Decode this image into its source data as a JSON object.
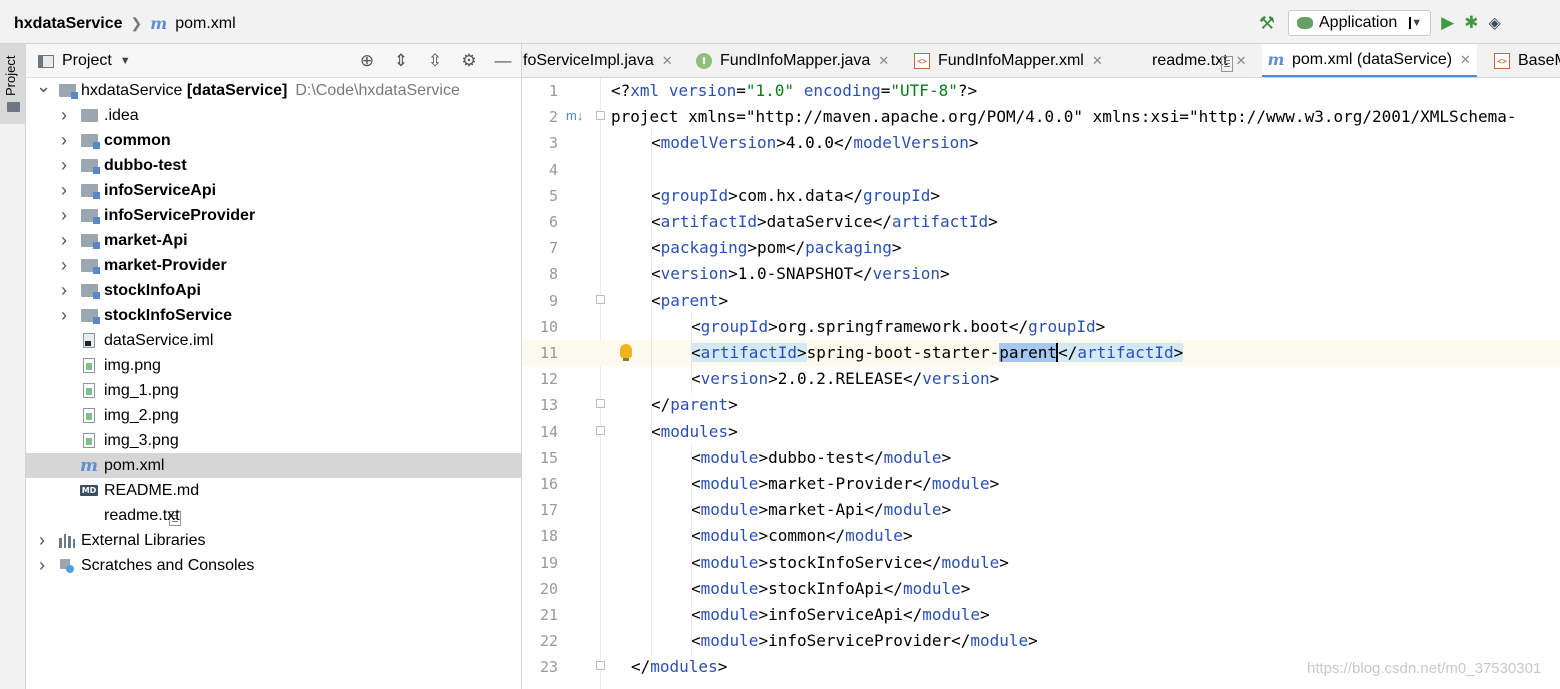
{
  "breadcrumb": {
    "project": "hxdataService",
    "separator": "❯",
    "file_icon": "m",
    "file": "pom.xml"
  },
  "toolbar": {
    "run_config": "Application",
    "build_icon": "hammer-icon",
    "run_icon": "run-icon",
    "debug_icon": "debug-icon",
    "coverage_icon": "coverage-icon"
  },
  "left_strip": {
    "label": "Project"
  },
  "project_panel": {
    "title": "Project"
  },
  "tree": [
    {
      "label": "hxdataService",
      "suffix": "[dataService]",
      "path": "D:\\Code\\hxdataService",
      "bold": false,
      "type": "module-root",
      "expanded": true
    },
    {
      "label": ".idea",
      "bold": false,
      "type": "folder"
    },
    {
      "label": "common",
      "bold": true,
      "type": "module"
    },
    {
      "label": "dubbo-test",
      "bold": true,
      "type": "module"
    },
    {
      "label": "infoServiceApi",
      "bold": true,
      "type": "module"
    },
    {
      "label": "infoServiceProvider",
      "bold": true,
      "type": "module"
    },
    {
      "label": "market-Api",
      "bold": true,
      "type": "module"
    },
    {
      "label": "market-Provider",
      "bold": true,
      "type": "module"
    },
    {
      "label": "stockInfoApi",
      "bold": true,
      "type": "module"
    },
    {
      "label": "stockInfoService",
      "bold": true,
      "type": "module"
    },
    {
      "label": "dataService.iml",
      "bold": false,
      "type": "iml"
    },
    {
      "label": "img.png",
      "bold": false,
      "type": "png"
    },
    {
      "label": "img_1.png",
      "bold": false,
      "type": "png"
    },
    {
      "label": "img_2.png",
      "bold": false,
      "type": "png"
    },
    {
      "label": "img_3.png",
      "bold": false,
      "type": "png"
    },
    {
      "label": "pom.xml",
      "bold": false,
      "type": "pom",
      "selected": true
    },
    {
      "label": "README.md",
      "bold": false,
      "type": "md"
    },
    {
      "label": "readme.txt",
      "bold": false,
      "type": "txt"
    },
    {
      "label": "External Libraries",
      "bold": false,
      "type": "libs"
    },
    {
      "label": "Scratches and Consoles",
      "bold": false,
      "type": "scratch"
    }
  ],
  "tabs": [
    {
      "label": "foServiceImpl.java",
      "icon": "none"
    },
    {
      "label": "FundInfoMapper.java",
      "icon": "interface-icon",
      "glyph": "I"
    },
    {
      "label": "FundInfoMapper.xml",
      "icon": "xml-icon",
      "glyph": "<>"
    },
    {
      "label": "readme.txt",
      "icon": "text-file-icon"
    },
    {
      "label": "pom.xml (dataService)",
      "icon": "maven-icon",
      "glyph": "m",
      "active": true
    },
    {
      "label": "BaseM",
      "icon": "xml-icon",
      "glyph": "<>"
    }
  ],
  "code_lines": [
    {
      "n": "1",
      "text": "<?xml version=\"1.0\" encoding=\"UTF-8\"?>"
    },
    {
      "n": "2",
      "text": "<project xmlns=\"http://maven.apache.org/POM/4.0.0\" xmlns:xsi=\"http://www.w3.org/2001/XMLSchema-"
    },
    {
      "n": "3",
      "text": "<modelVersion>4.0.0</modelVersion>"
    },
    {
      "n": "4",
      "text": ""
    },
    {
      "n": "5",
      "text": "<groupId>com.hx.data</groupId>"
    },
    {
      "n": "6",
      "text": "<artifactId>dataService</artifactId>"
    },
    {
      "n": "7",
      "text": "<packaging>pom</packaging>"
    },
    {
      "n": "8",
      "text": "<version>1.0-SNAPSHOT</version>"
    },
    {
      "n": "9",
      "text": "<parent>"
    },
    {
      "n": "10",
      "text": "<groupId>org.springframework.boot</groupId>"
    },
    {
      "n": "11",
      "text": "<artifactId>spring-boot-starter-parent</artifactId>"
    },
    {
      "n": "12",
      "text": "<version>2.0.2.RELEASE</version>"
    },
    {
      "n": "13",
      "text": "</parent>"
    },
    {
      "n": "14",
      "text": "<modules>"
    },
    {
      "n": "15",
      "text": "<module>dubbo-test</module>"
    },
    {
      "n": "16",
      "text": "<module>market-Provider</module>"
    },
    {
      "n": "17",
      "text": "<module>market-Api</module>"
    },
    {
      "n": "18",
      "text": "<module>common</module>"
    },
    {
      "n": "19",
      "text": "<module>stockInfoService</module>"
    },
    {
      "n": "20",
      "text": "<module>stockInfoApi</module>"
    },
    {
      "n": "21",
      "text": "<module>infoServiceApi</module>"
    },
    {
      "n": "22",
      "text": "<module>infoServiceProvider</module>"
    },
    {
      "n": "23",
      "text": "</modules>"
    }
  ],
  "current_line": "11",
  "watermark": "https://blog.csdn.net/m0_37530301",
  "colors": {
    "tag": "#2a50b5",
    "attr_value": "#067d17",
    "accent": "#4a89dc",
    "selection": "#a6c8f0"
  }
}
